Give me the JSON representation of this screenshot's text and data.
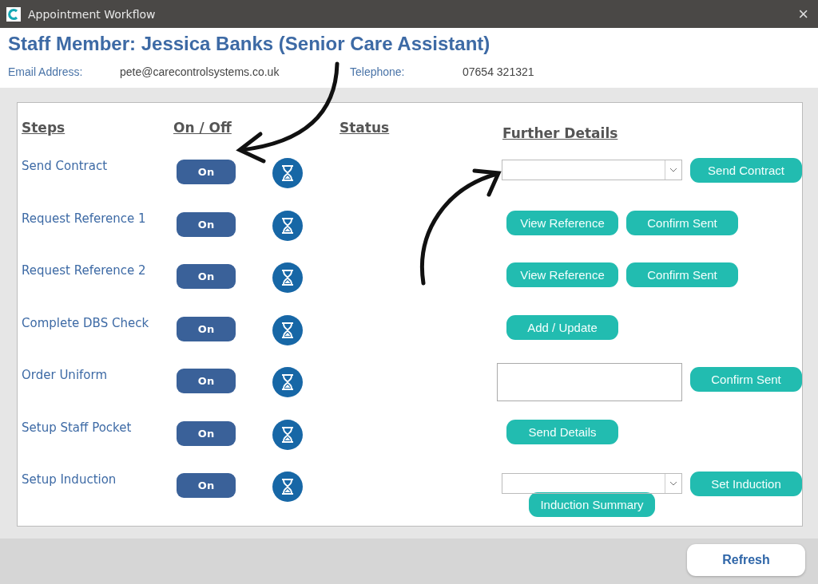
{
  "window": {
    "title": "Appointment Workflow",
    "close": "×"
  },
  "header": {
    "staff_member": "Staff Member: Jessica Banks (Senior Care Assistant)",
    "email_label": "Email Address:",
    "email": "pete@carecontrolsystems.co.uk",
    "telephone_label": "Telephone:",
    "telephone": "07654 321321"
  },
  "columns": [
    "Steps",
    "On / Off",
    "Status",
    "Further Details"
  ],
  "steps": [
    {
      "name": "Send Contract",
      "toggle": {
        "label": "On",
        "on": true
      },
      "details": [
        [
          {
            "kind": "select"
          },
          {
            "kind": "button",
            "label": "Send Contract"
          }
        ]
      ]
    },
    {
      "name": "Request Reference 1",
      "toggle": {
        "label": "On",
        "on": true
      },
      "details": [
        [
          {
            "kind": "button",
            "label": "View Reference"
          },
          {
            "kind": "button",
            "label": "Confirm Sent"
          }
        ]
      ]
    },
    {
      "name": "Request Reference 2",
      "toggle": {
        "label": "On",
        "on": true
      },
      "details": [
        [
          {
            "kind": "button",
            "label": "View Reference"
          },
          {
            "kind": "button",
            "label": "Confirm Sent"
          }
        ]
      ]
    },
    {
      "name": "Complete DBS Check",
      "toggle": {
        "label": "On",
        "on": true
      },
      "details": [
        [
          {
            "kind": "button",
            "label": "Add / Update"
          }
        ]
      ]
    },
    {
      "name": "Order Uniform",
      "toggle": {
        "label": "On",
        "on": true
      },
      "details": [
        [
          {
            "kind": "textbox"
          },
          {
            "kind": "button",
            "label": "Confirm Sent"
          }
        ]
      ]
    },
    {
      "name": "Setup Staff Pocket",
      "toggle": {
        "label": "On",
        "on": true
      },
      "details": [
        [
          {
            "kind": "button",
            "label": "Send Details"
          }
        ]
      ]
    },
    {
      "name": "Setup Induction",
      "toggle": {
        "label": "On",
        "on": true
      },
      "details": [
        [
          {
            "kind": "select"
          },
          {
            "kind": "button",
            "label": "Set Induction"
          }
        ],
        [
          {
            "kind": "button",
            "label": "Induction Summary"
          }
        ]
      ]
    }
  ],
  "footer": {
    "refresh": "Refresh"
  }
}
